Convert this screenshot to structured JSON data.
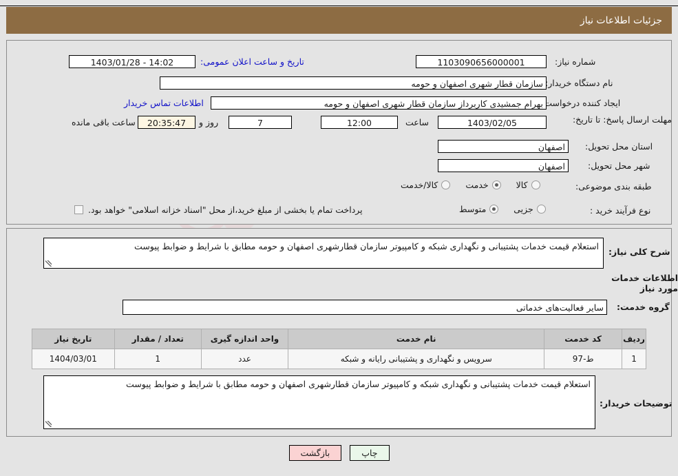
{
  "header": {
    "title": "جزئیات اطلاعات نیاز"
  },
  "form": {
    "need_number_label": "شماره نیاز:",
    "need_number_value": "1103090656000001",
    "announce_datetime_label": "تاریخ و ساعت اعلان عمومی:",
    "announce_datetime_value": "14:02 - 1403/01/28",
    "buyer_org_label": "نام دستگاه خریدار:",
    "buyer_org_value": "سازمان قطار شهری اصفهان و حومه",
    "requester_label": "ایجاد کننده درخواست:",
    "requester_value": "بهرام جمشیدی کاربرداز سازمان قطار شهری اصفهان و حومه",
    "contact_link": "اطلاعات تماس خریدار",
    "deadline_label": "مهلت ارسال پاسخ: تا تاریخ:",
    "deadline_date": "1403/02/05",
    "hour_label": "ساعت",
    "hour_value": "12:00",
    "days_value": "7",
    "days_unit_label": "روز و",
    "remaining_value": "20:35:47",
    "remaining_label": "ساعت باقی مانده",
    "province_label": "استان محل تحویل:",
    "province_value": "اصفهان",
    "city_label": "شهر محل تحویل:",
    "city_value": "اصفهان",
    "category_label": "طبقه بندی موضوعی:",
    "category_options": [
      {
        "label": "کالا",
        "selected": false
      },
      {
        "label": "خدمت",
        "selected": true
      },
      {
        "label": "کالا/خدمت",
        "selected": false
      }
    ],
    "process_label": "نوع فرآیند خرید :",
    "process_options": [
      {
        "label": "جزیی",
        "selected": false
      },
      {
        "label": "متوسط",
        "selected": true
      }
    ],
    "treasury_checkbox_label": "پرداخت تمام یا بخشی از مبلغ خرید،از محل \"اسناد خزانه اسلامی\" خواهد بود.",
    "treasury_checked": false
  },
  "description": {
    "summary_label": "شرح کلی نیاز:",
    "summary_value": "استعلام قیمت خدمات پشتیبانی و نگهداری شبکه و کامپیوتر سازمان قطارشهری اصفهان و حومه مطابق با شرایط و ضوابط پیوست",
    "services_heading": "اطلاعات خدمات مورد نیاز",
    "service_group_label": "گروه خدمت:",
    "service_group_value": "سایر فعالیت‌های خدماتی"
  },
  "table": {
    "columns": [
      "ردیف",
      "کد خدمت",
      "نام خدمت",
      "واحد اندازه گیری",
      "تعداد / مقدار",
      "تاریخ نیاز"
    ],
    "rows": [
      {
        "index": "1",
        "code": "ط-97",
        "name": "سرویس و نگهداری و پشتیبانی رایانه و شبکه",
        "unit": "عدد",
        "quantity": "1",
        "need_date": "1404/03/01"
      }
    ]
  },
  "buyer_notes": {
    "label": "توضیحات خریدار:",
    "value": "استعلام قیمت خدمات پشتیبانی و نگهداری شبکه و کامپیوتر سازمان قطارشهری اصفهان و حومه مطابق با شرایط و ضوابط پیوست"
  },
  "footer": {
    "print_label": "چاپ",
    "back_label": "بازگشت"
  },
  "watermark": {
    "text": "AnaTender.net"
  },
  "colors": {
    "header_bg": "#8d6c43",
    "link": "#1010c8",
    "print_bg": "#eaf7ea",
    "back_bg": "#fbd3d3"
  }
}
